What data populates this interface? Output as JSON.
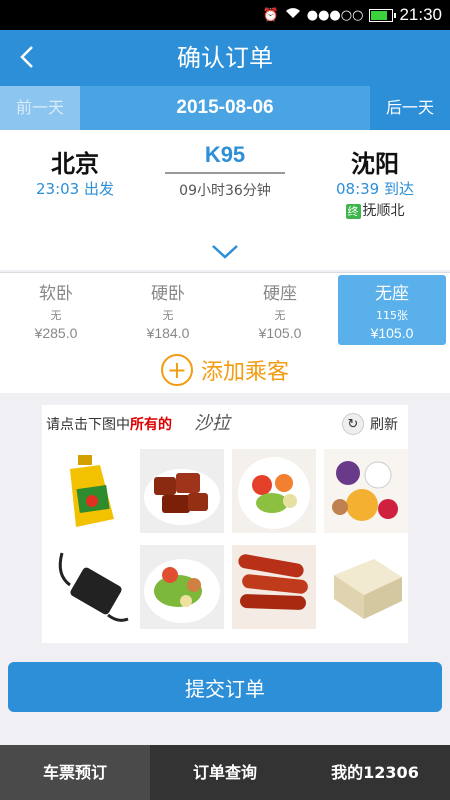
{
  "status": {
    "time": "21:30",
    "signal": "●●●○○"
  },
  "header": {
    "title": "确认订单"
  },
  "datebar": {
    "prev": "前一天",
    "date": "2015-08-06",
    "next": "后一天"
  },
  "train": {
    "from": "北京",
    "to": "沈阳",
    "number": "K95",
    "depart": "23:03 出发",
    "arrive": "08:39 到达",
    "duration": "09小时36分钟",
    "terminal_badge": "终",
    "terminal": "抚顺北"
  },
  "seats": [
    {
      "name": "软卧",
      "avail": "无",
      "price": "¥285.0"
    },
    {
      "name": "硬卧",
      "avail": "无",
      "price": "¥184.0"
    },
    {
      "name": "硬座",
      "avail": "无",
      "price": "¥105.0"
    },
    {
      "name": "无座",
      "avail": "115张",
      "price": "¥105.0",
      "selected": true
    }
  ],
  "add_passenger": "添加乘客",
  "captcha": {
    "prompt_prefix": "请点击下图中",
    "prompt_highlight": "所有的",
    "target_word": "沙拉",
    "refresh": "刷新",
    "images": [
      "oil-bottle",
      "braised-pork",
      "salad-bowl",
      "fruit-dessert",
      "power-adapter",
      "salad-plate",
      "sausages",
      "tofu"
    ]
  },
  "submit": "提交订单",
  "tabs": [
    "车票预订",
    "订单查询",
    "我的12306"
  ],
  "colors": {
    "primary": "#2c8fd8",
    "accent": "#f39c12",
    "highlight": "#d00000"
  }
}
